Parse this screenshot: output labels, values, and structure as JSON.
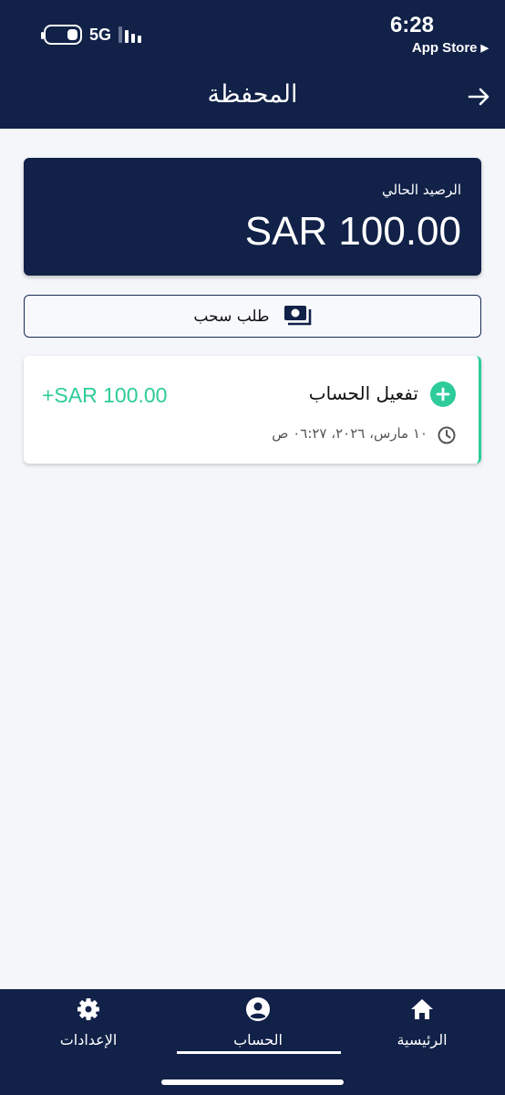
{
  "status_bar": {
    "network": "5G",
    "time": "6:28",
    "back_app": "App Store",
    "battery_level": 0.3
  },
  "header": {
    "title": "المحفظة",
    "nav_icon": "arrow-right-icon"
  },
  "balance": {
    "label": "الرصيد الحالي",
    "amount": "SAR 100.00"
  },
  "withdraw": {
    "label": "طلب سحب",
    "icon": "cash-icon"
  },
  "transactions": [
    {
      "title": "تفعيل الحساب",
      "amount": "+SAR 100.00",
      "date": "١٠ مارس، ٢٠٢٦، ٠٦:٢٧ ص",
      "icon": "plus-circle-icon",
      "time_icon": "clock-icon"
    }
  ],
  "bottom_nav": {
    "items": [
      {
        "label": "الإعدادات",
        "icon": "gear-icon"
      },
      {
        "label": "الحساب",
        "icon": "account-circle-icon",
        "active": true
      },
      {
        "label": "الرئيسية",
        "icon": "home-icon"
      }
    ]
  },
  "colors": {
    "primary": "#112148",
    "accent": "#2ecc9a",
    "background": "#f4f6fa"
  }
}
